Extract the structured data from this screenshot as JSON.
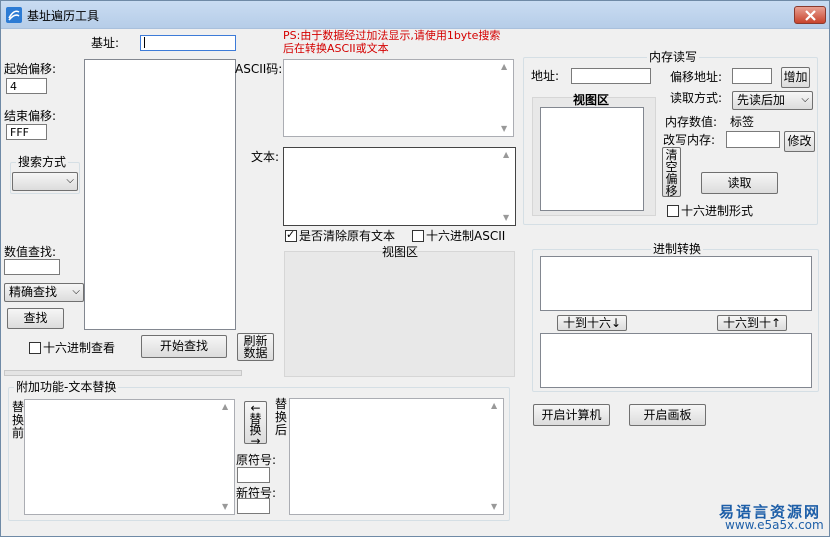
{
  "window": {
    "title": "基址遍历工具"
  },
  "left": {
    "base_label": "基址:",
    "start_offset_label": "起始偏移:",
    "start_offset_value": "4",
    "end_offset_label": "结束偏移:",
    "end_offset_value": "FFF",
    "search_mode_label": "搜索方式",
    "search_mode_value": "",
    "value_search_label": "数值查找:",
    "match_mode": "精确查找",
    "find_btn": "查找",
    "hex_view_label": "十六进制查看",
    "start_search_btn": "开始查找",
    "refresh_btn": "刷新数据"
  },
  "middle": {
    "notice": "PS:由于数据经过加法显示,请使用1byte搜索后在转换ASCII或文本",
    "ascii_label": "ASCII码:",
    "text_label": "文本:",
    "clear_text_label": "是否清除原有文本",
    "hex_ascii_label": "十六进制ASCII",
    "view_area_label": "视图区"
  },
  "memory": {
    "group_title": "内存读写",
    "address_label": "地址:",
    "view_area_label": "视图区",
    "offset_address_label": "偏移地址:",
    "add_btn": "增加",
    "read_mode_label": "读取方式:",
    "read_mode_value": "先读后加",
    "mem_value_label": "内存数值:",
    "mem_value": "标签",
    "write_label": "改写内存:",
    "modify_btn": "修改",
    "clear_offset_btn": "清空偏移",
    "read_btn": "读取",
    "hex_form_label": "十六进制形式"
  },
  "radix": {
    "group_title": "进制转换",
    "dec_to_hex_btn": "十到十六↓",
    "hex_to_dec_btn": "十六到十↑"
  },
  "tools": {
    "calc_btn": "开启计算机",
    "paint_btn": "开启画板"
  },
  "replace": {
    "group_title": "附加功能-文本替换",
    "before_label": "替换前",
    "after_label": "替换后",
    "replace_btn": "←替换→",
    "old_symbol_label": "原符号:",
    "new_symbol_label": "新符号:"
  },
  "watermark": {
    "line1": "易语言资源网",
    "line2": "www.e5a5x.com"
  }
}
